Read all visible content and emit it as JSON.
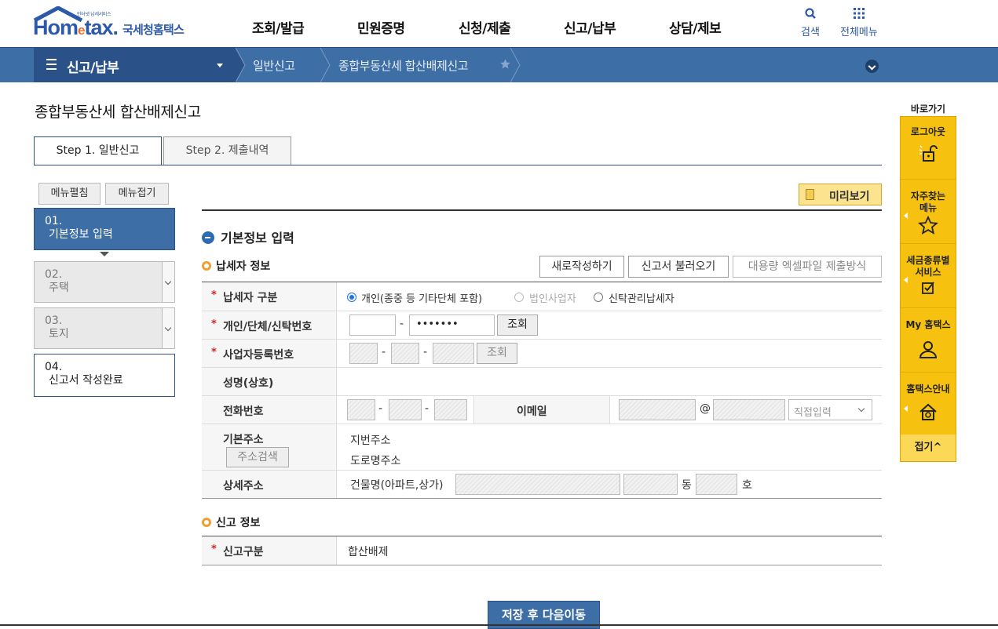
{
  "logo": {
    "small": "인터넷 납세서비스",
    "word_a": "Hom",
    "word_e": "e",
    "word_b": "tax.",
    "kr": "국세청홈택스"
  },
  "gnb": [
    "조회/발급",
    "민원증명",
    "신청/제출",
    "신고/납부",
    "상담/제보"
  ],
  "util": {
    "search": "검색",
    "all_menu": "전체메뉴"
  },
  "navbar": {
    "menu_title": "신고/납부",
    "crumb1": "일반신고",
    "crumb2": "종합부동산세 합산배제신고"
  },
  "page_title": "종합부동산세 합산배제신고",
  "tabs": [
    "Step 1. 일반신고",
    "Step 2. 제출내역"
  ],
  "side_buttons": {
    "expand": "메뉴펼침",
    "collapse": "메뉴접기"
  },
  "steps": [
    {
      "num": "01.",
      "label": "기본정보 입력"
    },
    {
      "num": "02.",
      "label": "주택"
    },
    {
      "num": "03.",
      "label": "토지"
    },
    {
      "num": "04.",
      "label": "신고서 작성완료"
    }
  ],
  "preview": "미리보기",
  "section_title": "기본정보 입력",
  "taxpayer": {
    "title": "납세자 정보",
    "buttons": {
      "new": "새로작성하기",
      "load": "신고서 불러오기",
      "excel": "대용량 엑셀파일 제출방식"
    },
    "type_label": "납세자 구분",
    "type_options": [
      "개인(종중 등 기타단체 포함)",
      "법인사업자",
      "신탁관리납세자"
    ],
    "id_label": "개인/단체/신탁번호",
    "id_masked": "•••••••",
    "lookup": "조회",
    "bizno_label": "사업자등록번호",
    "name_label": "성명(상호)",
    "phone_label": "전화번호",
    "email_label": "이메일",
    "email_domain_select": "직접입력",
    "address_label": "기본주소",
    "address_search": "주소검색",
    "addr_lot": "지번주소",
    "addr_road": "도로명주소",
    "detail_label": "상세주소",
    "building": "건물명(아파트,상가)",
    "dong": "동",
    "ho": "호"
  },
  "report": {
    "title": "신고 정보",
    "type_label": "신고구분",
    "type_value": "합산배제"
  },
  "save_next": "저장 후 다음이동",
  "quick": {
    "title": "바로가기",
    "items": [
      "로그아웃",
      "자주찾는 메뉴",
      "세금종류별 서비스",
      "My 홈택스",
      "홈택스안내"
    ],
    "close": "접기^"
  },
  "colors": {
    "brand_blue": "#3e6ea6",
    "nav_dark": "#2b5288",
    "quick_yellow": "#f6c20f",
    "required_red": "#dd2222"
  }
}
